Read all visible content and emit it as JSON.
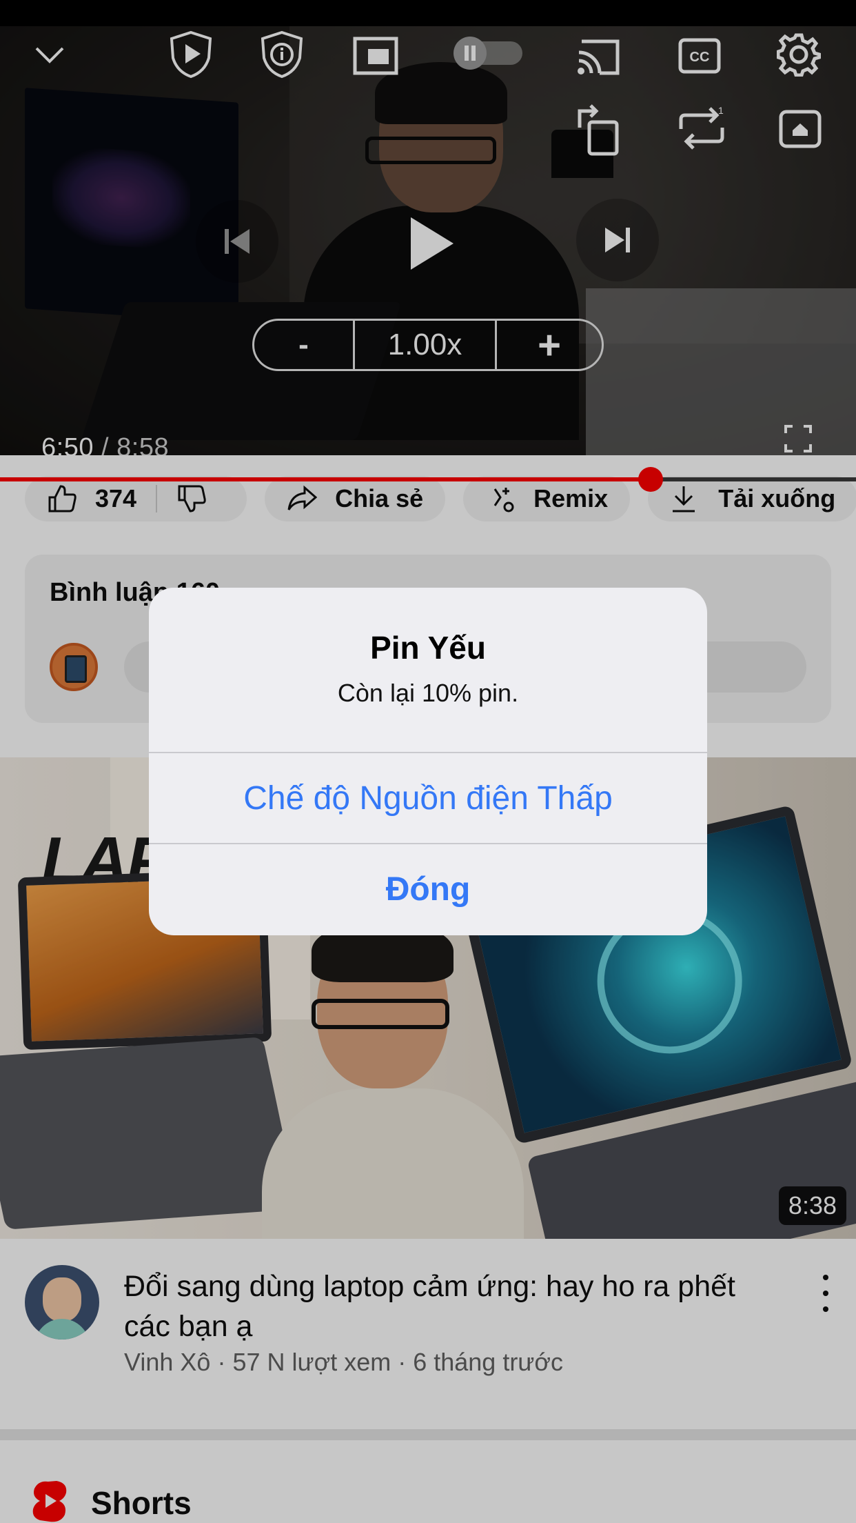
{
  "player": {
    "time_current": "6:50",
    "time_separator": " / ",
    "time_total": "8:58",
    "speed_minus": "-",
    "speed_value": "1.00x",
    "speed_plus": "+",
    "progress_fraction": 0.76,
    "progress_color": "#ff0000",
    "top_icons": [
      "chevron-down-icon",
      "shield-play-icon",
      "shield-info-icon",
      "picture-in-picture-icon",
      "pause-toggle-icon",
      "cast-icon",
      "closed-captions-icon",
      "gear-icon"
    ],
    "second_row_icons": [
      "rotate-icon",
      "repeat-one-icon",
      "home-icon"
    ],
    "center_icons": [
      "previous-icon",
      "play-icon",
      "next-icon"
    ]
  },
  "actions": {
    "like_count": "374",
    "share_label": "Chia sẻ",
    "remix_label": "Remix",
    "download_label": "Tải xuống"
  },
  "comments": {
    "title": "Bình luận 160"
  },
  "alert": {
    "title": "Pin Yếu",
    "message": "Còn lại 10% pin.",
    "primary_action": "Chế độ Nguồn điện Thấp",
    "cancel_action": "Đóng",
    "action_color": "#3478f6"
  },
  "video": {
    "thumbnail_word": "LAP",
    "duration": "8:38",
    "title": "Đổi sang dùng laptop cảm ứng: hay ho ra phết các bạn ạ",
    "channel": "Vinh Xô",
    "views": "57 N lượt xem",
    "age": "6 tháng trước",
    "meta_separator": " · "
  },
  "shorts": {
    "label": "Shorts",
    "brand_color": "#ff0000"
  }
}
